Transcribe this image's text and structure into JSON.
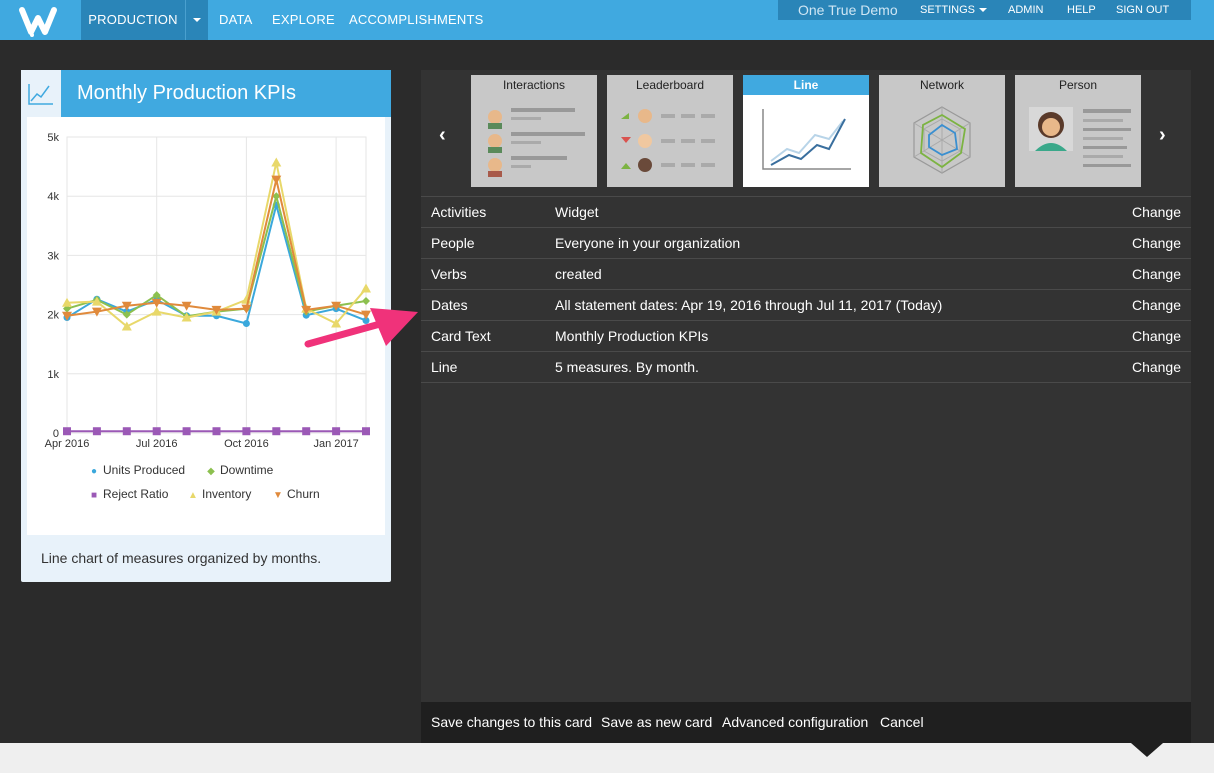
{
  "nav": {
    "production": "PRODUCTION",
    "data": "DATA",
    "explore": "EXPLORE",
    "accomplishments": "ACCOMPLISHMENTS",
    "demo": "One True Demo",
    "settings": "SETTINGS",
    "admin": "ADMIN",
    "help": "HELP",
    "signout": "SIGN OUT"
  },
  "card": {
    "title": "Monthly Production KPIs",
    "footer": "Line chart of measures organized by months."
  },
  "chart_data": {
    "type": "line",
    "x": [
      "Apr 2016",
      "May 2016",
      "Jun 2016",
      "Jul 2016",
      "Aug 2016",
      "Sep 2016",
      "Oct 2016",
      "Nov 2016",
      "Dec 2016",
      "Jan 2017",
      "Feb 2017"
    ],
    "xticks": [
      "Apr 2016",
      "Jul 2016",
      "Oct 2016",
      "Jan 2017"
    ],
    "yticks": [
      "0",
      "1k",
      "2k",
      "3k",
      "4k",
      "5k"
    ],
    "ylim": [
      0,
      5000
    ],
    "legend_placement": "bottom",
    "series": [
      {
        "name": "Units Produced",
        "color": "#3aa8dc",
        "marker": "circle",
        "values": [
          1950,
          2260,
          2050,
          2250,
          1980,
          1980,
          1850,
          3850,
          1990,
          2100,
          1900
        ]
      },
      {
        "name": "Downtime",
        "color": "#8cc04f",
        "marker": "diamond",
        "values": [
          2100,
          2250,
          2000,
          2330,
          1970,
          2050,
          2100,
          4000,
          2050,
          2150,
          2230
        ]
      },
      {
        "name": "Reject Ratio",
        "color": "#9b59b6",
        "marker": "square",
        "values": [
          30,
          30,
          30,
          30,
          30,
          30,
          30,
          30,
          30,
          30,
          30
        ]
      },
      {
        "name": "Inventory",
        "color": "#e8d86a",
        "marker": "triangle",
        "values": [
          2200,
          2220,
          1800,
          2050,
          1950,
          2050,
          2250,
          4570,
          2100,
          1850,
          2440
        ]
      },
      {
        "name": "Churn",
        "color": "#e08a3c",
        "marker": "triangle-down",
        "values": [
          1980,
          2050,
          2150,
          2200,
          2150,
          2080,
          2100,
          4280,
          2080,
          2150,
          2000
        ]
      }
    ]
  },
  "carousel": {
    "tiles": [
      {
        "label": "Interactions"
      },
      {
        "label": "Leaderboard"
      },
      {
        "label": "Line"
      },
      {
        "label": "Network"
      },
      {
        "label": "Person"
      }
    ],
    "prev": "‹",
    "next": "›"
  },
  "rows": [
    {
      "label": "Activities",
      "value": "Widget",
      "action": "Change"
    },
    {
      "label": "People",
      "value": "Everyone in your organization",
      "action": "Change"
    },
    {
      "label": "Verbs",
      "value": "created",
      "action": "Change"
    },
    {
      "label": "Dates",
      "value": "All statement dates: Apr 19, 2016 through Jul 11, 2017 (Today)",
      "action": "Change"
    },
    {
      "label": "Card Text",
      "value": "Monthly Production KPIs",
      "action": "Change"
    },
    {
      "label": "Line",
      "value": "5 measures. By month.",
      "action": "Change"
    }
  ],
  "actions": {
    "save": "Save changes to this card",
    "save_new": "Save as new card",
    "advanced": "Advanced configuration",
    "cancel": "Cancel"
  }
}
